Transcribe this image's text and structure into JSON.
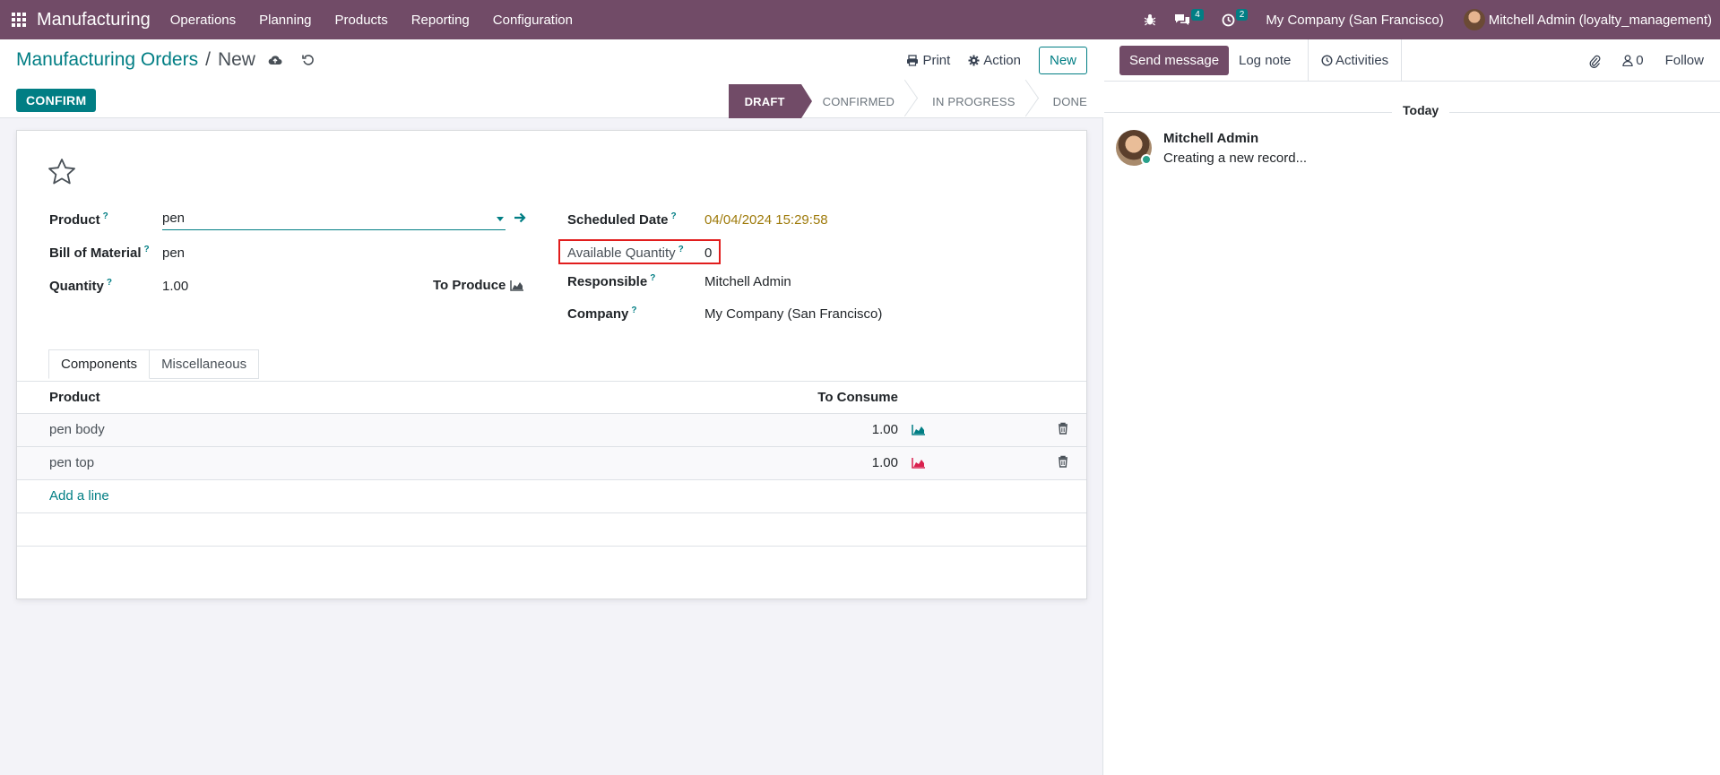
{
  "navbar": {
    "app_name": "Manufacturing",
    "menu": [
      "Operations",
      "Planning",
      "Products",
      "Reporting",
      "Configuration"
    ],
    "messages_count": "4",
    "activities_count": "2",
    "company": "My Company (San Francisco)",
    "user": "Mitchell Admin (loyalty_management)"
  },
  "control_panel": {
    "breadcrumb_parent": "Manufacturing Orders",
    "breadcrumb_sep": "/",
    "breadcrumb_current": "New",
    "print_label": "Print",
    "action_label": "Action",
    "new_label": "New",
    "confirm_label": "CONFIRM"
  },
  "statusbar": {
    "stages": [
      "DRAFT",
      "CONFIRMED",
      "IN PROGRESS",
      "DONE"
    ],
    "active": "DRAFT"
  },
  "form": {
    "product_label": "Product",
    "product_value": "pen",
    "bom_label": "Bill of Material",
    "bom_value": "pen",
    "quantity_label": "Quantity",
    "quantity_value": "1.00",
    "to_produce_label": "To Produce",
    "scheduled_label": "Scheduled Date",
    "scheduled_value": "04/04/2024 15:29:58",
    "available_label": "Available Quantity",
    "available_value": "0",
    "responsible_label": "Responsible",
    "responsible_value": "Mitchell Admin",
    "company_label": "Company",
    "company_value": "My Company (San Francisco)",
    "help_mark": "?"
  },
  "tabs": [
    "Components",
    "Miscellaneous"
  ],
  "components": {
    "col_product": "Product",
    "col_consume": "To Consume",
    "rows": [
      {
        "product": "pen body",
        "qty": "1.00",
        "forecast_color": "#017e84"
      },
      {
        "product": "pen top",
        "qty": "1.00",
        "forecast_color": "#d9214e"
      }
    ],
    "add_line": "Add a line"
  },
  "chatter": {
    "send_message": "Send message",
    "log_note": "Log note",
    "activities": "Activities",
    "followers_count": "0",
    "follow": "Follow",
    "today": "Today",
    "message_author": "Mitchell Admin",
    "message_body": "Creating a new record..."
  }
}
